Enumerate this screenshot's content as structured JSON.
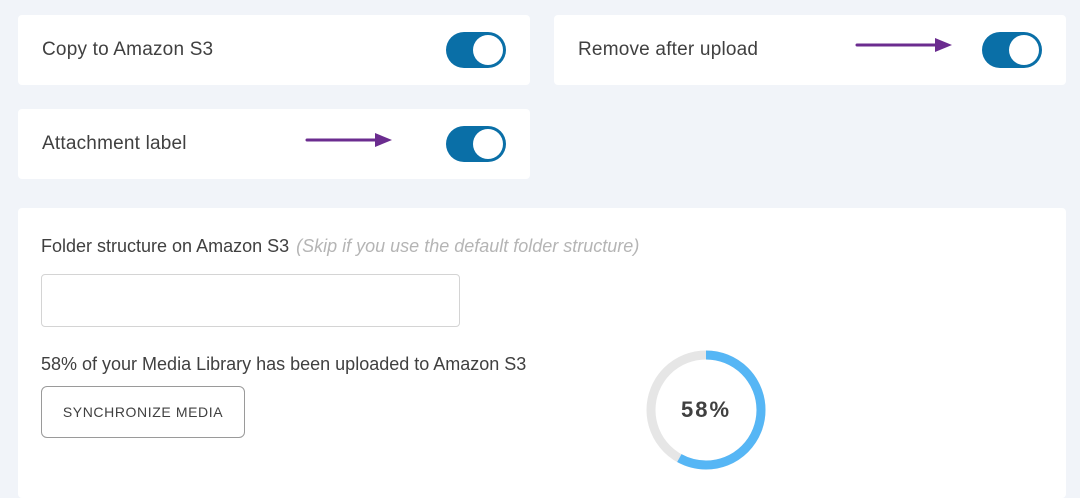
{
  "toggles": {
    "copy_to_s3": {
      "label": "Copy to Amazon S3",
      "enabled": true
    },
    "remove_after_upload": {
      "label": "Remove after upload",
      "enabled": true
    },
    "attachment_label": {
      "label": "Attachment label",
      "enabled": true
    }
  },
  "folder": {
    "label": "Folder structure on Amazon S3",
    "hint": "(Skip if you use the default folder structure)",
    "value": "",
    "placeholder": ""
  },
  "media": {
    "progress_text": "58% of your Media Library has been uploaded to Amazon S3",
    "sync_button_label": "SYNCHRONIZE MEDIA",
    "progress_percent": 58,
    "progress_label": "58%"
  },
  "colors": {
    "toggle_on": "#0a6fa7",
    "arrow": "#6b2c8f",
    "donut_track": "#e6e6e6",
    "donut_fill": "#56b6f5"
  }
}
